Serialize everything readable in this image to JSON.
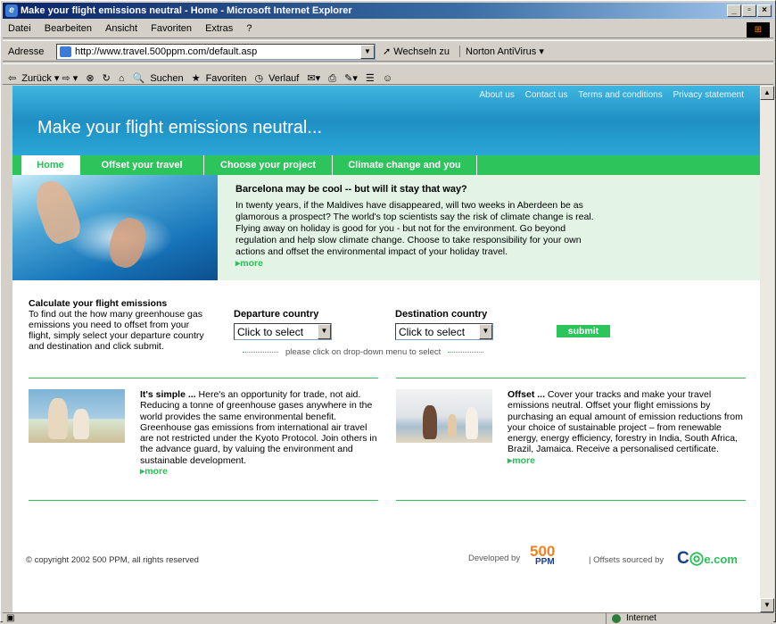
{
  "window": {
    "title": "Make your flight emissions neutral - Home - Microsoft Internet Explorer",
    "controls": [
      "_",
      "и",
      "X"
    ]
  },
  "menu": [
    "Datei",
    "Bearbeiten",
    "Ansicht",
    "Favoriten",
    "Extras",
    "?"
  ],
  "address": {
    "label": "Adresse",
    "url": "http://www.travel.500ppm.com/default.asp",
    "go_label": "Wechseln zu",
    "norton": "Norton AntiVirus"
  },
  "toolbar": {
    "back": "Zurück",
    "search": "Suchen",
    "favorites": "Favoriten",
    "history": "Verlauf"
  },
  "page": {
    "top_links": [
      "About us",
      "Contact us",
      "Terms and conditions",
      "Privacy statement"
    ],
    "headline": "Make your flight emissions neutral...",
    "nav": [
      "Home",
      "Offset your travel",
      "Choose your project",
      "Climate change and you"
    ],
    "hero": {
      "title": "Barcelona may be cool -- but will it stay that way?",
      "body": "In twenty years, if the Maldives have disappeared, will two weeks in Aberdeen be as glamorous a prospect? The world's top scientists say the risk of climate change is real. Flying away on holiday is good for you - but not for the environment. Go beyond regulation and help slow climate change. Choose to take responsibility for your own actions and offset the environmental impact of your holiday travel.",
      "more": "more"
    },
    "calculator": {
      "title": "Calculate your flight emissions",
      "body": "To find out the how many greenhouse gas emissions you need to offset from your flight, simply select your departure country and destination and click submit.",
      "departure_label": "Departure country",
      "departure_value": "Click to select",
      "destination_label": "Destination country",
      "destination_value": "Click to select",
      "submit": "submit",
      "hint": "please click on drop-down menu to select"
    },
    "card1": {
      "lead": "It's simple ...",
      "body": " Here's an opportunity for trade, not aid. Reducing a tonne of greenhouse gases anywhere in the world provides the same environmental benefit. Greenhouse gas emissions from international air travel are not restricted under the Kyoto Protocol. Join others in the advance guard, by valuing the environment and sustainable development.",
      "more": "more"
    },
    "card2": {
      "lead": "Offset ...",
      "body": " Cover your tracks and make your travel emissions neutral. Offset your flight emissions by purchasing an equal amount of emission reductions from your choice of sustainable project – from renewable energy, energy efficiency, forestry in India, South Africa, Brazil, Jamaica. Receive a personalised certificate.",
      "more": "more"
    },
    "footer": {
      "copyright": "© copyright 2002 500 PPM, all rights reserved",
      "developed": "Developed by",
      "ppm_logo": "500",
      "ppm_sub": "PPM",
      "offsets": "| Offsets sourced by",
      "co2_logo": "C",
      "co2_suffix": "e.com"
    }
  },
  "status": {
    "zone": "Internet"
  },
  "colors": {
    "accent_green": "#2bbf58",
    "header_blue": "#1f8fc4",
    "hero_bg": "#e3f4e7"
  }
}
